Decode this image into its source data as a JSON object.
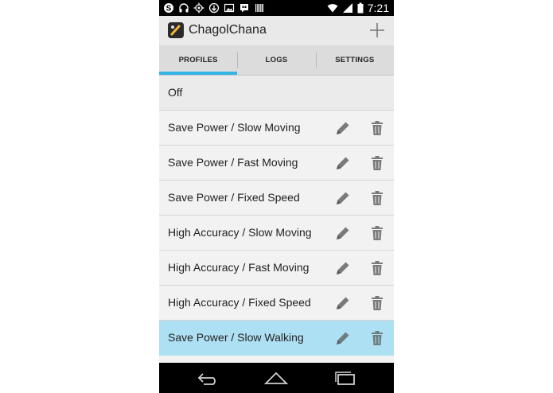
{
  "status_bar": {
    "time": "7:21",
    "left_icons": [
      "skype-icon",
      "headphones-icon",
      "gps-icon",
      "download-icon",
      "image-icon",
      "hangouts-icon",
      "barcode-icon"
    ],
    "right_icons": [
      "wifi-icon",
      "signal-icon",
      "battery-icon"
    ]
  },
  "action_bar": {
    "title": "ChagolChana",
    "app_icon": "app-logo-icon",
    "add_icon": "plus-icon"
  },
  "tabs": [
    {
      "label": "PROFILES",
      "active": true
    },
    {
      "label": "LOGS",
      "active": false
    },
    {
      "label": "SETTINGS",
      "active": false
    }
  ],
  "profiles": [
    {
      "label": "Off",
      "editable": false
    },
    {
      "label": "Save Power / Slow Moving",
      "editable": true
    },
    {
      "label": "Save Power / Fast Moving",
      "editable": true
    },
    {
      "label": "Save Power / Fixed Speed",
      "editable": true
    },
    {
      "label": "High Accuracy / Slow Moving",
      "editable": true
    },
    {
      "label": "High Accuracy / Fast Moving",
      "editable": true
    },
    {
      "label": "High Accuracy / Fixed Speed",
      "editable": true
    },
    {
      "label": "Save Power / Slow Walking",
      "editable": true,
      "selected": true
    }
  ],
  "row_icons": {
    "edit": "pencil-icon",
    "delete": "trash-icon"
  },
  "nav_bar": {
    "icons": [
      "back-icon",
      "home-icon",
      "recent-apps-icon"
    ]
  },
  "colors": {
    "tab_indicator": "#33b5e5",
    "selected_row": "#aee0f3",
    "icon_gray": "#7a7a7a"
  }
}
